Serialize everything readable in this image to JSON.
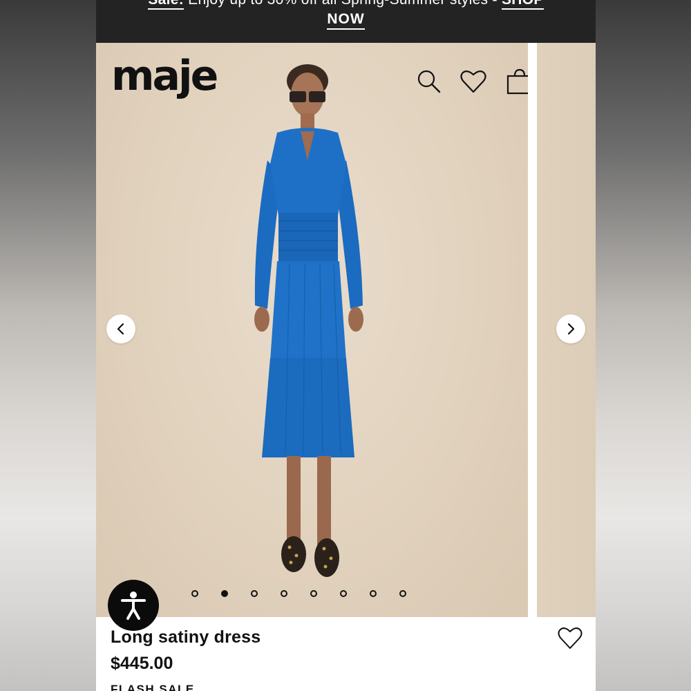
{
  "banner": {
    "sale_label": "Sale:",
    "message": "Enjoy up to 30% off all Spring-Summer styles",
    "dash": "-",
    "cta_part1": "SHOP",
    "cta_part2": "NOW"
  },
  "header": {
    "logo": "maje",
    "icons": [
      "search-icon",
      "heart-icon",
      "shopping-bag-icon",
      "menu-icon"
    ]
  },
  "gallery": {
    "prev_icon": "chevron-left-icon",
    "next_icon": "chevron-right-icon",
    "image_count": 8,
    "active_index": 1
  },
  "product": {
    "name": "Long satiny dress",
    "price": "$445.00",
    "tag": "FLASH SALE",
    "wishlist_icon": "heart-icon"
  },
  "colors": {
    "banner_bg": "#232323",
    "dress_blue": "#1c6fc4",
    "photo_bg": "#e2d3bf",
    "text": "#111111"
  }
}
